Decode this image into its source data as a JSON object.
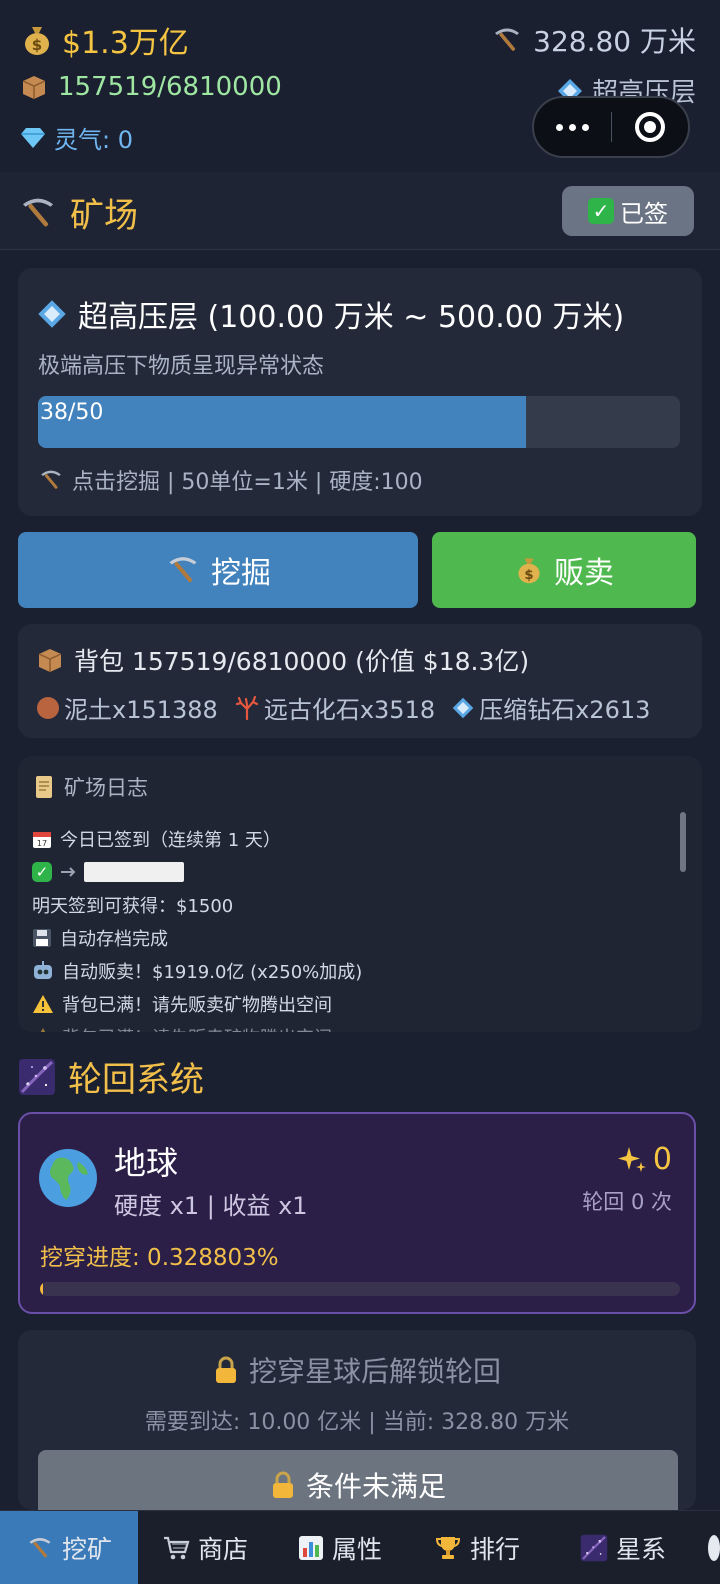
{
  "status": {
    "money": "$1.3万亿",
    "depth": "328.80 万米",
    "bag_capacity": "157519/6810000",
    "layer_tag": "超高压层",
    "spirit": "灵气: 0"
  },
  "mine": {
    "title": "矿场",
    "signed_label": "已签",
    "layer": {
      "name": "超高压层 (100.00 万米 ~ 500.00 万米)",
      "desc": "极端高压下物质呈现异常状态",
      "progress_text": "38/50",
      "progress_fraction": 0.76,
      "info": "点击挖掘 | 50单位=1米 | 硬度:100"
    },
    "dig_label": "挖掘",
    "sell_label": "贩卖",
    "bag": {
      "title": "背包 157519/6810000 (价值 $18.3亿)",
      "items": [
        {
          "icon": "dirt-icon",
          "label": "泥土x151388"
        },
        {
          "icon": "fossil-icon",
          "label": "远古化石x3518"
        },
        {
          "icon": "diamond-icon",
          "label": "压缩钻石x2613"
        }
      ]
    },
    "log": {
      "title": "矿场日志",
      "lines": [
        {
          "icon": "calendar-icon",
          "text": "今日已签到（连续第 1 天）"
        },
        {
          "icon": "check-icon",
          "text": ""
        },
        {
          "icon": "",
          "text": "明天签到可获得：$1500"
        },
        {
          "icon": "floppy-icon",
          "text": "自动存档完成"
        },
        {
          "icon": "robot-icon",
          "text": "自动贩卖！$1919.0亿 (x250%加成)"
        },
        {
          "icon": "warning-icon",
          "text": "背包已满！请先贩卖矿物腾出空间"
        },
        {
          "icon": "warning-icon",
          "text": "背包已满！请先贩卖矿物腾出空间"
        }
      ]
    }
  },
  "reincarnation": {
    "title": "轮回系统",
    "planet": {
      "name": "地球",
      "stats": "硬度 x1 | 收益 x1",
      "stars": "0",
      "count": "轮回 0 次",
      "progress_label": "挖穿进度: 0.328803%",
      "progress_fraction": 0.00328803
    },
    "lock": {
      "title": "挖穿星球后解锁轮回",
      "need": "需要到达: 10.00 亿米 | 当前: 328.80 万米",
      "button_label": "条件未满足"
    }
  },
  "nav": {
    "items": [
      {
        "icon": "pickaxe-icon",
        "label": "挖矿",
        "active": true
      },
      {
        "icon": "cart-icon",
        "label": "商店",
        "active": false
      },
      {
        "icon": "chart-icon",
        "label": "属性",
        "active": false
      },
      {
        "icon": "trophy-icon",
        "label": "排行",
        "active": false
      },
      {
        "icon": "galaxy-icon",
        "label": "星系",
        "active": false
      }
    ]
  },
  "colors": {
    "accent_blue": "#4282bd",
    "sell_green": "#4fb84e",
    "gold": "#f2c04a",
    "purple_border": "#6a4fa8"
  }
}
